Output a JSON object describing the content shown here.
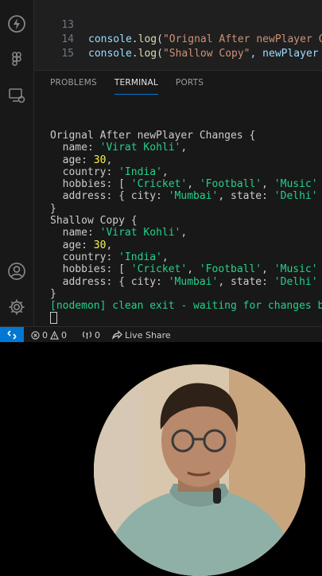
{
  "editor": {
    "lines": [
      {
        "num": "13",
        "obj": "console",
        "fn": "log",
        "str": "\"Orignal After newPlayer C",
        "rest": ""
      },
      {
        "num": "14",
        "obj": "console",
        "fn": "log",
        "str": "\"Shallow Copy\"",
        "rest": ", newPlayer"
      },
      {
        "num": "15",
        "obj": "",
        "fn": "",
        "str": "",
        "rest": ""
      }
    ]
  },
  "panel": {
    "tabs": [
      "PROBLEMS",
      "TERMINAL",
      "PORTS"
    ],
    "active_tab": "TERMINAL"
  },
  "terminal": {
    "block1_header": "Orignal After newPlayer Changes {",
    "block2_header": "Shallow Copy {",
    "name_key": "  name: ",
    "name_val": "'Virat Kohli'",
    "age_key": "  age: ",
    "age_val": "30",
    "country_key": "  country: ",
    "country_val": "'India'",
    "hobbies_key": "  hobbies: [ ",
    "hobby1": "'Cricket'",
    "hobby2": "'Football'",
    "hobby3": "'Music'",
    "hobbies_end": " ]",
    "address_key": "  address: { city: ",
    "city1": "'Mumbai'",
    "city2": "'Mumbai'",
    "state_key": ", state: ",
    "state_val": "'Delhi'",
    "address_end": " }",
    "close": "}",
    "nodemon": "[nodemon] clean exit - waiting for changes before restart"
  },
  "statusbar": {
    "errors": "0",
    "warnings": "0",
    "ports": "0",
    "live_share": "Live Share"
  },
  "colors": {
    "accent": "#0078d4",
    "terminal_string": "#23d18b",
    "terminal_number": "#f5f543"
  }
}
